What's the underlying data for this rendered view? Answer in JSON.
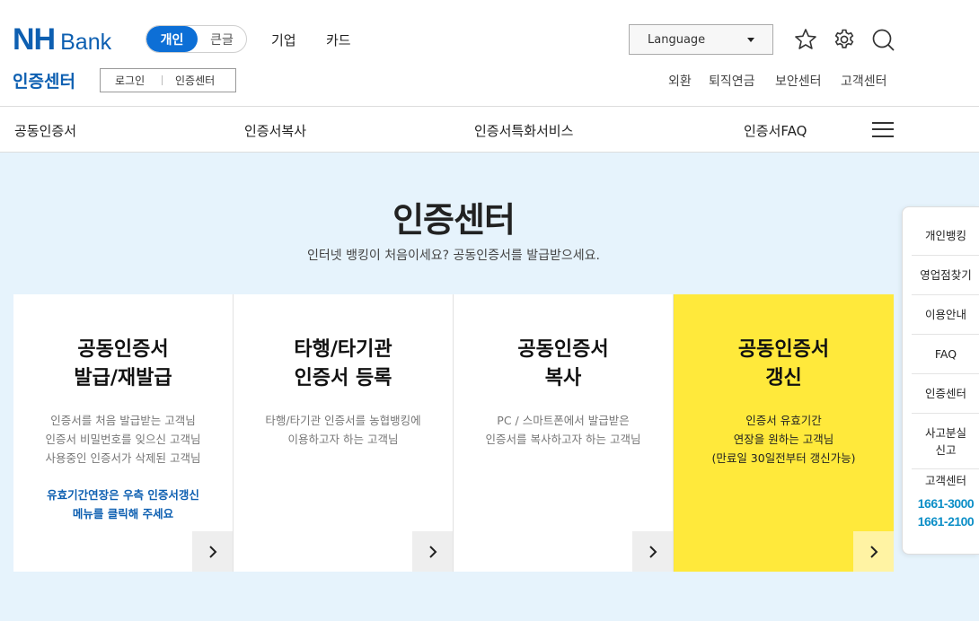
{
  "header": {
    "logo_nh": "NH",
    "logo_bank": "Bank",
    "toggle": {
      "active": "개인",
      "inactive": "큰글"
    },
    "top_menu": [
      "기업",
      "카드"
    ],
    "language": "Language",
    "icons": [
      "star-icon",
      "gear-icon",
      "search-icon"
    ],
    "section_title": "인증센터",
    "sub_links": [
      "로그인",
      "인증센터"
    ],
    "util_links": [
      "외환",
      "퇴직연금",
      "보안센터",
      "고객센터"
    ]
  },
  "nav": {
    "items": [
      "공동인증서",
      "인증서복사",
      "인증서특화서비스",
      "인증서FAQ"
    ]
  },
  "main": {
    "title": "인증센터",
    "subtitle": "인터넷 뱅킹이 처음이세요? 공동인증서를 발급받으세요.",
    "cards": [
      {
        "title": "공동인증서\n발급/재발급",
        "desc": "인증서를 처음 발급받는 고객님\n인증서 비밀번호를 잊으신 고객님\n사용중인 인증서가 삭제된 고객님",
        "note": "유효기간연장은 우측 인증서갱신\n메뉴를 클릭해 주세요"
      },
      {
        "title": "타행/타기관\n인증서 등록",
        "desc": "타행/타기관 인증서를 농협뱅킹에\n이용하고자 하는 고객님",
        "note": ""
      },
      {
        "title": "공동인증서\n복사",
        "desc": "PC / 스마트폰에서 발급받은\n인증서를 복사하고자 하는 고객님",
        "note": ""
      },
      {
        "title": "공동인증서\n갱신",
        "desc": "인증서 유효기간\n연장을 원하는 고객님\n(만료일 30일전부터 갱신가능)",
        "note": ""
      }
    ]
  },
  "quick_menu": {
    "items": [
      "개인뱅킹",
      "영업점찾기",
      "이용안내",
      "FAQ",
      "인증센터",
      "사고분실\n신고"
    ],
    "contact_label": "고객센터",
    "phones": [
      "1661-3000",
      "1661-2100"
    ]
  },
  "colors": {
    "brand_blue": "#0d5fb1",
    "toggle_blue": "#0d6fd6",
    "highlight_yellow": "#ffe93b",
    "bg_light_blue": "#e6f3fc"
  }
}
